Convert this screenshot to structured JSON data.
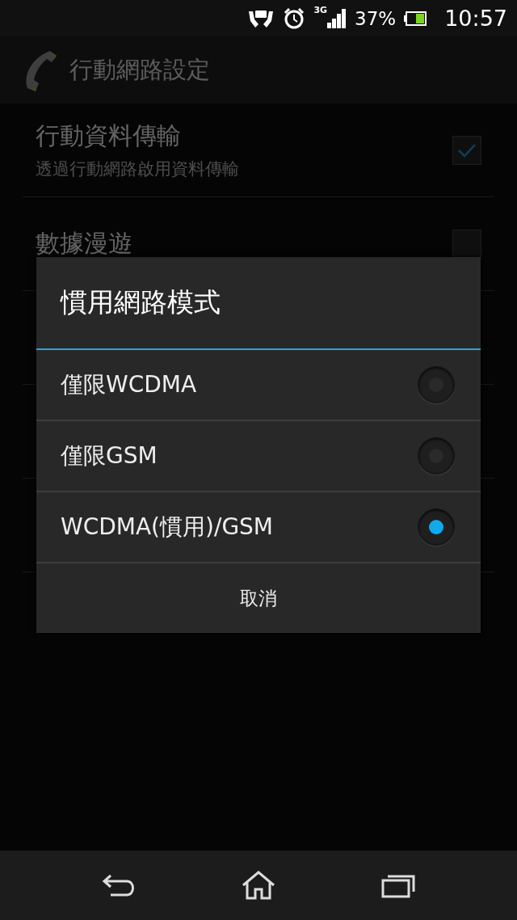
{
  "status_bar": {
    "network": "3G",
    "battery": "37%",
    "time": "10:57"
  },
  "action_bar": {
    "title": "行動網路設定"
  },
  "settings": [
    {
      "title": "行動資料傳輸",
      "summary": "透過行動網路啟用資料傳輸",
      "checked": true
    },
    {
      "title": "數據漫遊",
      "checked": false
    }
  ],
  "dialog": {
    "title": "慣用網路模式",
    "options": [
      {
        "label": "僅限WCDMA",
        "selected": false
      },
      {
        "label": "僅限GSM",
        "selected": false
      },
      {
        "label": "WCDMA(慣用)/GSM",
        "selected": true
      }
    ],
    "buttons": [
      "取消"
    ]
  }
}
